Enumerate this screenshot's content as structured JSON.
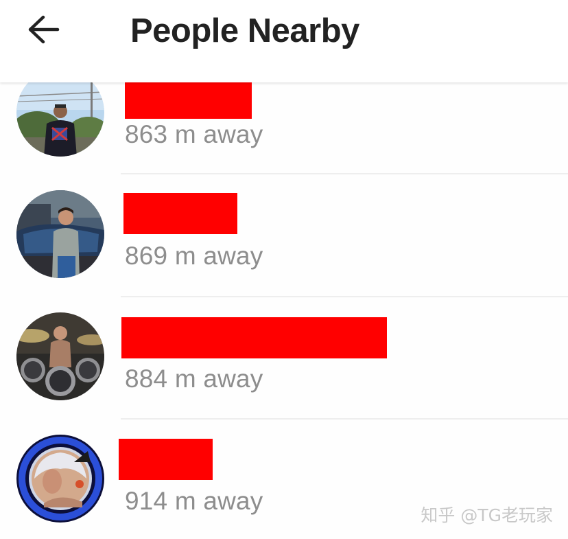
{
  "header": {
    "title": "People Nearby",
    "back_icon": "arrow-left-icon"
  },
  "people": [
    {
      "distance": "863 m away"
    },
    {
      "distance": "869 m away"
    },
    {
      "distance": "884 m away"
    },
    {
      "distance": "914 m away"
    }
  ],
  "watermark": "知乎 @TG老玩家",
  "colors": {
    "redaction": "#ff0000",
    "title": "#222222",
    "distance": "#8d8d8d",
    "divider": "#eeeeee"
  }
}
